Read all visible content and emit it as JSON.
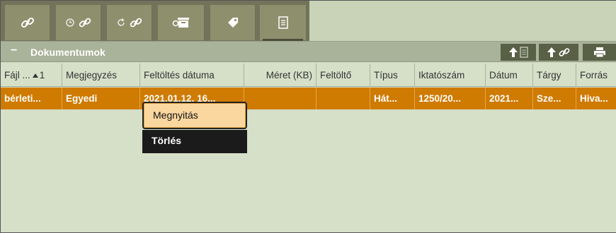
{
  "toolbar": {
    "tabs": [
      {
        "icon": "link-icon"
      },
      {
        "icon": "history-link-icon"
      },
      {
        "icon": "refresh-link-icon"
      },
      {
        "icon": "archive-box-icon"
      },
      {
        "icon": "tag-icon"
      },
      {
        "icon": "document-icon",
        "active": true
      }
    ]
  },
  "section": {
    "collapse_symbol": "−",
    "title": "Dokumentumok",
    "buttons": [
      {
        "icon": "upload-document-icon"
      },
      {
        "icon": "upload-link-icon"
      },
      {
        "icon": "print-icon"
      }
    ]
  },
  "table": {
    "columns": [
      "Fájl ...",
      "1",
      "Megjegyzés",
      "Feltöltés dátuma",
      "Méret (KB)",
      "Feltöltő",
      "Típus",
      "Iktatószám",
      "Dátum",
      "Tárgy",
      "Forrás"
    ],
    "rows": [
      {
        "file": "bérleti...",
        "note": "Egyedi",
        "uploaded": "2021.01.12. 16...",
        "size": "",
        "uploader": "",
        "type": "Hát...",
        "reg_no": "1250/20...",
        "date": "2021...",
        "subject": "Sze...",
        "source": "Hiva..."
      }
    ]
  },
  "context_menu": {
    "open_label": "Megnyitás",
    "delete_label": "Törlés"
  },
  "colors": {
    "selected_row": "#cf7a00",
    "toolbar_tab": "#8e8f6d",
    "section_header": "#a9b399",
    "background": "#d6e0c9"
  }
}
